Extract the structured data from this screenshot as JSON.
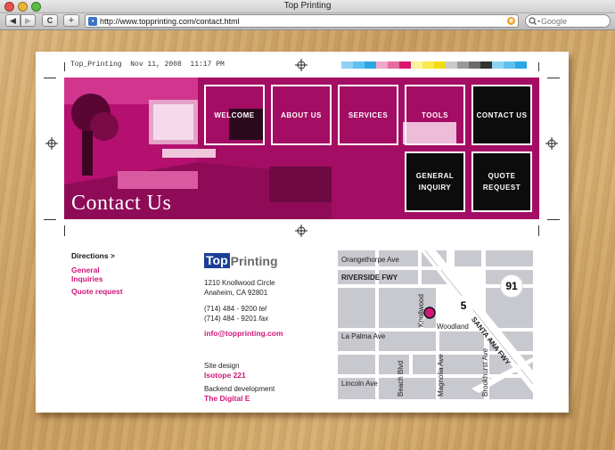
{
  "window": {
    "title": "Top Printing"
  },
  "browser": {
    "url": "http://www.topprinting.com/contact.html",
    "search_placeholder": "Google",
    "back_label": "◀",
    "forward_label": "▶",
    "reload_label": "C",
    "add_label": "+"
  },
  "print_meta": "Top_Printing  Nov 11, 2008  11:17 PM",
  "swatch_colors": [
    "#8fd3f4",
    "#5cc1ee",
    "#2aa7e4",
    "#f2a8c9",
    "#e56ca3",
    "#d8176e",
    "#fdf39a",
    "#f8e84a",
    "#f3db14",
    "#c9c9c9",
    "#9a9a9a",
    "#6b6b6b",
    "#333333",
    "#8fd3f4",
    "#5cc1ee",
    "#2aa7e4"
  ],
  "hero": {
    "title": "Contact Us",
    "nav": [
      "WELCOME",
      "ABOUT US",
      "SERVICES",
      "TOOLS",
      "CONTACT US"
    ],
    "sub_nav": [
      "GENERAL INQUIRY",
      "QUOTE REQUEST"
    ]
  },
  "sidebar": {
    "directions": "Directions >",
    "general": "General Inquiries",
    "quote": "Quote request"
  },
  "logo": {
    "top": "Top",
    "printing": "Printing"
  },
  "address": {
    "line1": "1210 Knollwood Circle",
    "line2": "Anaheim, CA 92801",
    "tel_number": "(714) 484 - 9200",
    "tel_label": "tel",
    "fax_number": "(714) 484 - 9201",
    "fax_label": "fax",
    "email": "info@topprinting.com"
  },
  "credits": {
    "site_design_label": "Site design",
    "site_design_name": "Isotope 221",
    "backend_label": "Backend development",
    "backend_name": "The Digital E"
  },
  "map": {
    "streets": [
      "Orangethorpe Ave",
      "RIVERSIDE FWY",
      "La Palma Ave",
      "Lincoln Ave",
      "Beach Blvd",
      "Magnolia Ave",
      "Brookhurst Ave",
      "Knollwood",
      "Woodland",
      "SANTA ANA FWY"
    ],
    "route_91": "91",
    "route_5": "5"
  },
  "colors": {
    "accent": "#d01679",
    "hero": "#c0127a",
    "logo_blue": "#1c3f95"
  }
}
